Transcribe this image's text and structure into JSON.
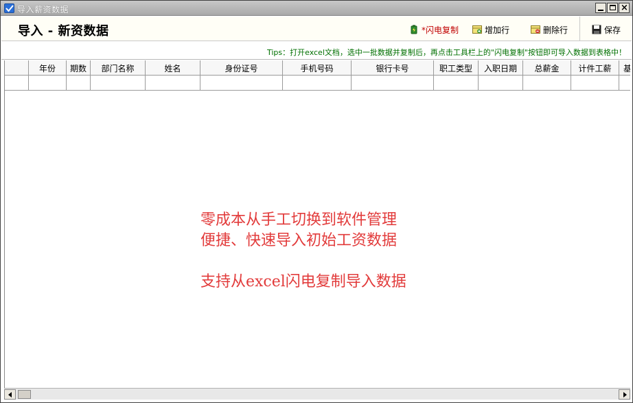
{
  "window": {
    "title": "导入薪资数据",
    "controls": {
      "minimize": "_",
      "maximize": "□",
      "close": "×"
    }
  },
  "toolbar": {
    "page_title": "导入 - 新资数据",
    "buttons": {
      "flash_copy": "*闪电复制",
      "add_row": "增加行",
      "delete_row": "删除行",
      "save": "保存"
    }
  },
  "tips": "Tips：打开excel文档，选中一批数据并复制后，再点击工具栏上的\"闪电复制\"按钮即可导入数据到表格中！",
  "table": {
    "columns": [
      "",
      "年份",
      "期数",
      "部门名称",
      "姓名",
      "身份证号",
      "手机号码",
      "银行卡号",
      "职工类型",
      "入职日期",
      "总薪金",
      "计件工薪",
      "基"
    ],
    "rows": [
      [
        "",
        "",
        "",
        "",
        "",
        "",
        "",
        "",
        "",
        "",
        "",
        "",
        ""
      ]
    ]
  },
  "center_note": {
    "line1": "零成本从手工切换到软件管理",
    "line2": "便捷、快速导入初始工资数据",
    "line3": "支持从excel闪电复制导入数据"
  },
  "colors": {
    "flash_copy_text": "#c00000",
    "tips_text": "#007000",
    "note_text": "#e23b3b"
  }
}
